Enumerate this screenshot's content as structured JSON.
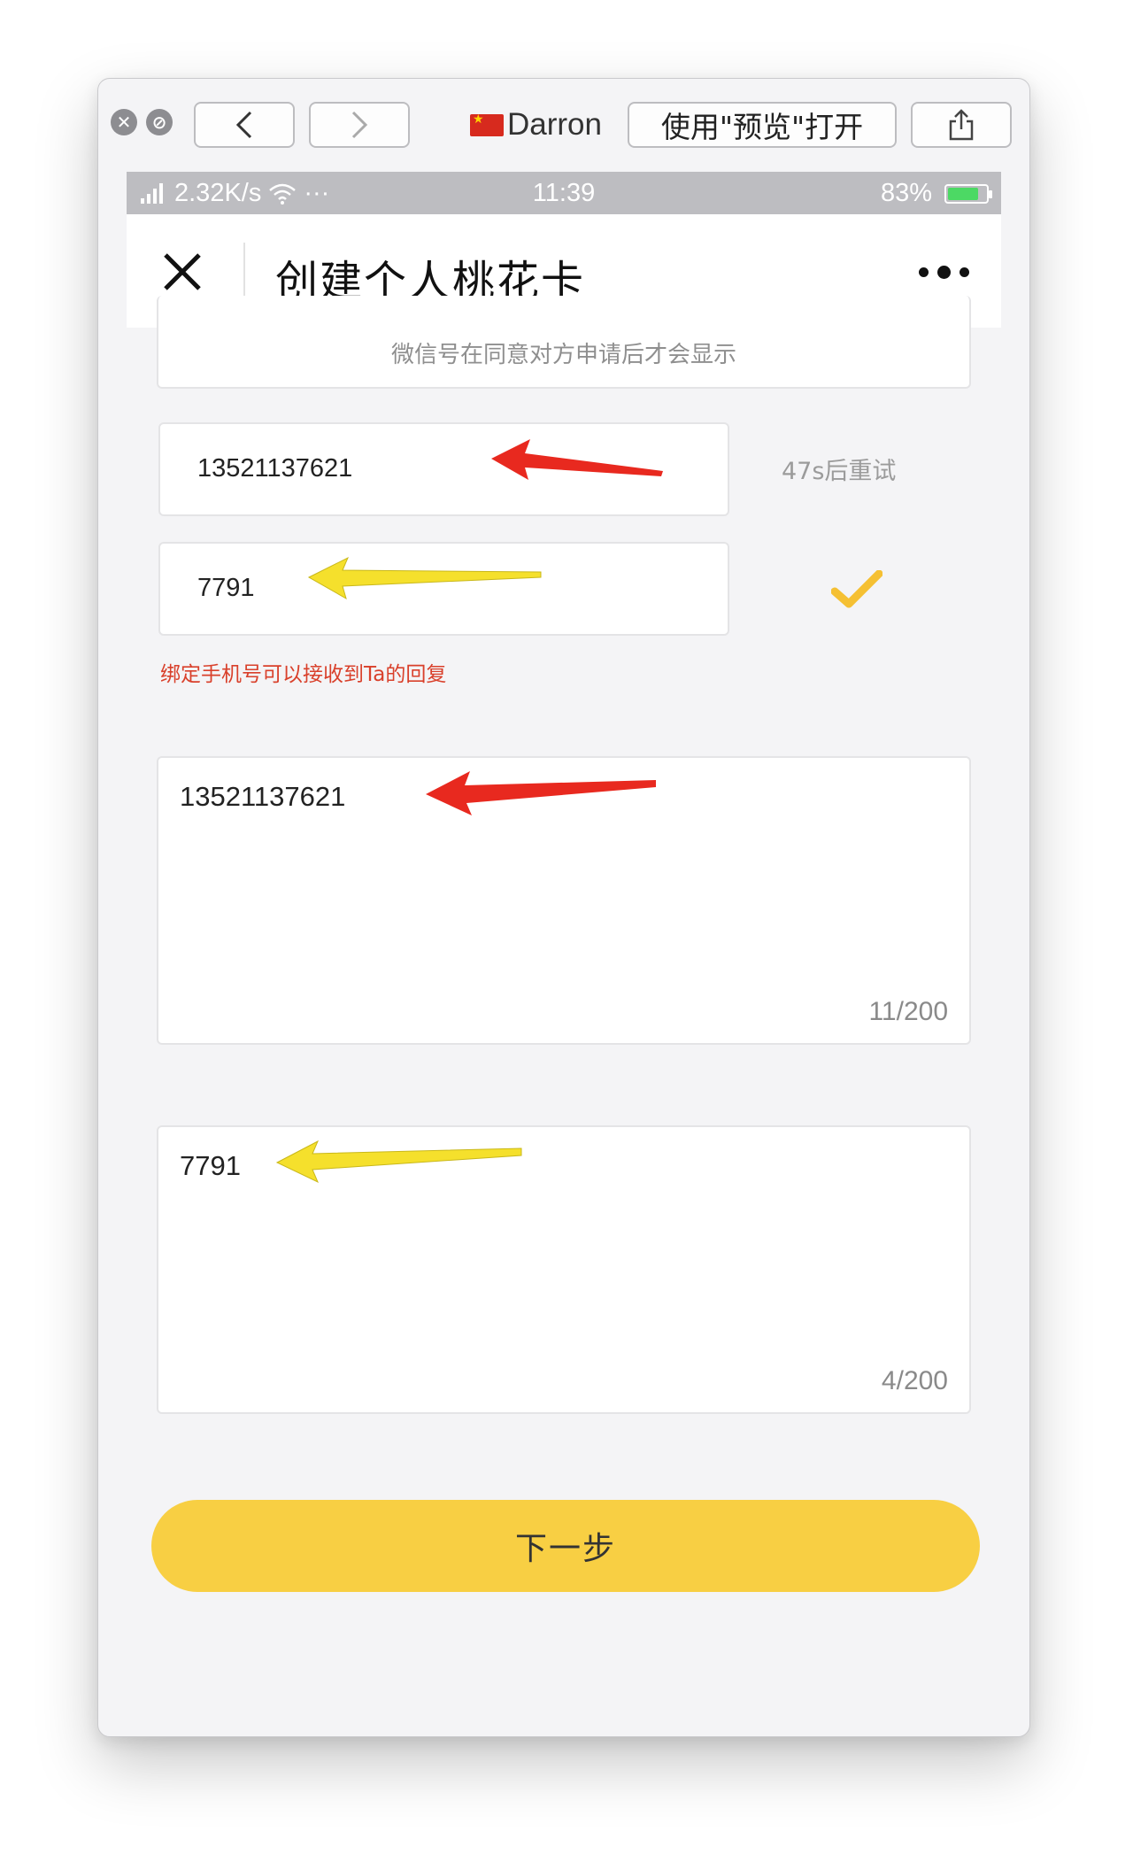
{
  "toolbar": {
    "account_name": "Darron",
    "open_preview_label": "使用\"预览\"打开"
  },
  "status_bar": {
    "network": "2.32K/s",
    "time": "11:39",
    "battery": "83%",
    "battery_level": 0.83
  },
  "navbar": {
    "title": "创建个人桃花卡"
  },
  "form": {
    "wechat_hint": "微信号在同意对方申请后才会显示",
    "phone_value": "13521137621",
    "retry_label": "47s后重试",
    "code_value": "7791",
    "bind_hint": "绑定手机号可以接收到Ta的回复",
    "message1_value": "13521137621",
    "message1_counter": "11/200",
    "message2_value": "7791",
    "message2_counter": "4/200",
    "next_label": "下一步"
  },
  "colors": {
    "accent": "#f8cf43",
    "error": "#d9402b",
    "check": "#f5c033",
    "arrow_red": "#e8291f",
    "arrow_yellow": "#f5e02c"
  }
}
